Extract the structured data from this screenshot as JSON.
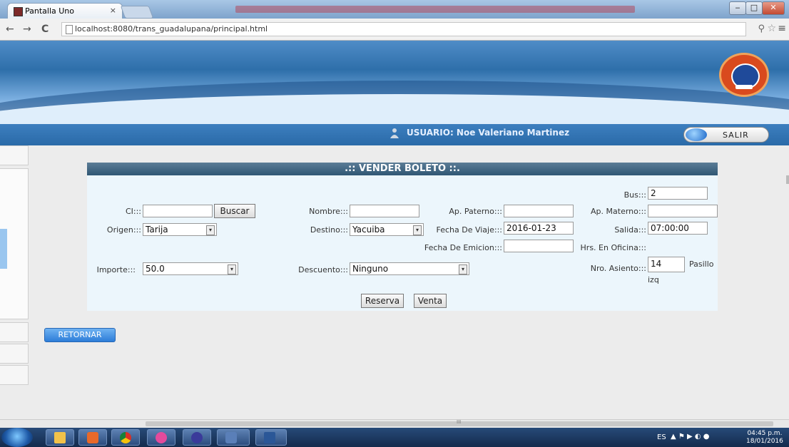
{
  "browser": {
    "tab_title": "Pantalla Uno",
    "tab_close": "×",
    "url": "localhost:8080/trans_guadalupana/principal.html",
    "nav": {
      "back": "←",
      "forward": "→",
      "reload": "C"
    },
    "icons": {
      "zoom": "⚲",
      "star": "☆",
      "menu": "≡"
    },
    "window_buttons": {
      "minimize": "‒",
      "maximize": "□",
      "close": "✕"
    }
  },
  "userbar": {
    "user_text": "USUARIO:  Noe Valeriano Martinez",
    "salir_label": "SALIR"
  },
  "form": {
    "title": ".:: VENDER BOLETO ::.",
    "labels": {
      "ci": "CI:::",
      "origen": "Origen:::",
      "importe": "Importe:::",
      "nombre": "Nombre:::",
      "destino": "Destino:::",
      "descuento": "Descuento:::",
      "ap_paterno": "Ap. Paterno:::",
      "fecha_viaje": "Fecha De Viaje:::",
      "fecha_emision": "Fecha De Emicion:::",
      "bus": "Bus:::",
      "ap_materno": "Ap. Materno:::",
      "salida": "Salida:::",
      "hrs_oficina": "Hrs. En Oficina:::",
      "nro_asiento": "Nro. Asiento:::",
      "pasillo": "Pasillo",
      "izq": "izq"
    },
    "values": {
      "ci": "",
      "nombre": "",
      "ap_paterno": "",
      "ap_materno": "",
      "origen": "Tarija",
      "destino": "Yacuiba",
      "importe": "50.0",
      "descuento": "Ninguno",
      "fecha_viaje": "2016-01-23",
      "fecha_emision": "",
      "bus": "2",
      "salida": "07:00:00",
      "nro_asiento": "14"
    },
    "buttons": {
      "buscar": "Buscar",
      "reserva": "Reserva",
      "venta": "Venta"
    }
  },
  "retornar_label": "RETORNAR",
  "scrollbar": {
    "marker": "III"
  },
  "taskbar": {
    "language": "ES",
    "tray": "▲ ⚑ ▶ ◐ ●",
    "clock_time": "04:45 p.m.",
    "clock_date": "18/01/2016"
  },
  "colors": {
    "header_bar": "#2f5774",
    "form_bg": "#ecf6fc",
    "user_bar": "#2a6aa8",
    "retornar": "#2d7dd8"
  }
}
